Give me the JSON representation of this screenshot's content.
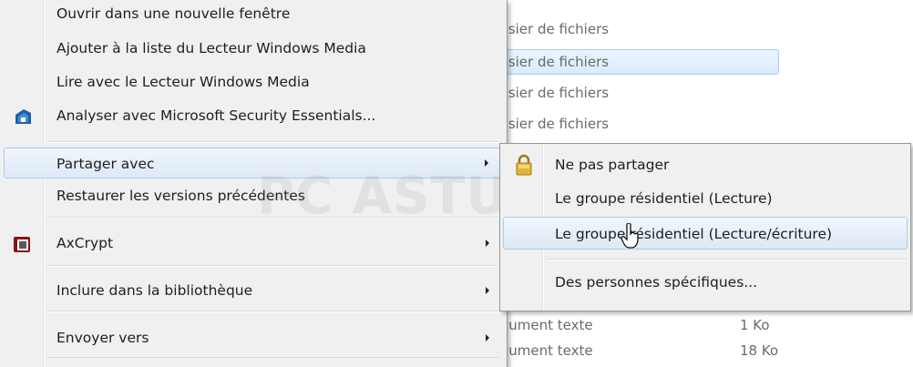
{
  "background_list": {
    "rows": [
      {
        "type": "ssier de fichiers",
        "size": ""
      },
      {
        "type": "ssier de fichiers",
        "size": ""
      },
      {
        "type": "ssier de fichiers",
        "size": ""
      },
      {
        "type": "ssier de fichiers",
        "size": ""
      },
      {
        "type": "cument texte",
        "size": "1 Ko"
      },
      {
        "type": "cument texte",
        "size": "18 Ko"
      }
    ]
  },
  "context_menu": {
    "items": [
      {
        "label": "Ouvrir dans une nouvelle fenêtre"
      },
      {
        "label": "Ajouter à la liste du Lecteur Windows Media"
      },
      {
        "label": "Lire avec le Lecteur Windows Media"
      },
      {
        "label": "Analyser avec Microsoft Security Essentials...",
        "icon": "security-essentials-icon"
      },
      {
        "label": "Partager avec",
        "has_submenu": true
      },
      {
        "label": "Restaurer les versions précédentes"
      },
      {
        "label": "AxCrypt",
        "icon": "axcrypt-icon",
        "has_submenu": true
      },
      {
        "label": "Inclure dans la bibliothèque",
        "has_submenu": true
      },
      {
        "label": "Envoyer vers",
        "has_submenu": true
      }
    ]
  },
  "submenu": {
    "items": [
      {
        "label": "Ne pas partager",
        "icon": "lock-icon"
      },
      {
        "label": "Le groupe résidentiel (Lecture)"
      },
      {
        "label": "Le groupe résidentiel (Lecture/écriture)"
      },
      {
        "label": "Des personnes spécifiques..."
      }
    ]
  },
  "watermark": {
    "text": "PC ASTUCES"
  },
  "colors": {
    "menu_bg": "#f0f0f0",
    "hover_border": "#aecbea",
    "selection_bg": "#d9ecfc"
  }
}
